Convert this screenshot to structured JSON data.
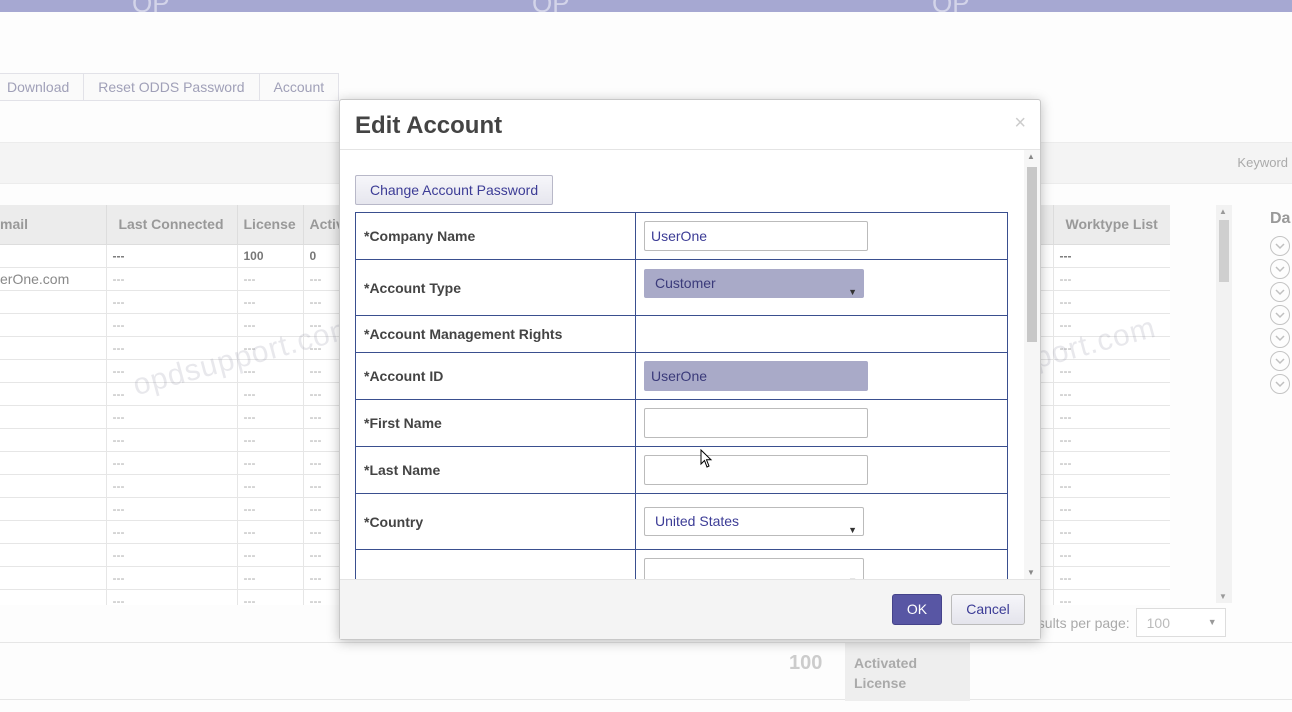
{
  "toolbar": {
    "download_label": "Download",
    "reset_odds_label": "Reset ODDS Password",
    "account_label": "Account"
  },
  "filter": {
    "keyword_label": "Keyword"
  },
  "grid": {
    "columns": [
      "mail",
      "Last Connected",
      "License",
      "Activ",
      "",
      "",
      "Worktype List"
    ],
    "first_row": [
      "",
      "---",
      "100",
      "0",
      "",
      "",
      "---"
    ],
    "email_partial": "erOne.com",
    "placeholder": "---"
  },
  "side": {
    "title": "Da"
  },
  "pager": {
    "label": "esults per page:",
    "value": "100"
  },
  "summary": {
    "count": "100",
    "label_line1": "Activated",
    "label_line2": "License"
  },
  "watermark": {
    "text": "opdsupport.com",
    "top_mark": "OP"
  },
  "modal": {
    "title": "Edit Account",
    "close": "×",
    "change_password_label": "Change Account Password",
    "fields": {
      "company_name": {
        "label": "*Company Name",
        "value": "UserOne"
      },
      "account_type": {
        "label": "*Account Type",
        "value": "Customer"
      },
      "management_rights": {
        "label": "*Account Management Rights"
      },
      "account_id": {
        "label": "*Account ID",
        "value": "UserOne"
      },
      "first_name": {
        "label": "*First Name",
        "value": ""
      },
      "last_name": {
        "label": "*Last Name",
        "value": ""
      },
      "country": {
        "label": "*Country",
        "value": "United States"
      }
    },
    "ok_label": "OK",
    "cancel_label": "Cancel"
  },
  "colors": {
    "accent": "#5856a4",
    "topbar": "#a6a8d2",
    "form_border": "#3a4f8f"
  }
}
